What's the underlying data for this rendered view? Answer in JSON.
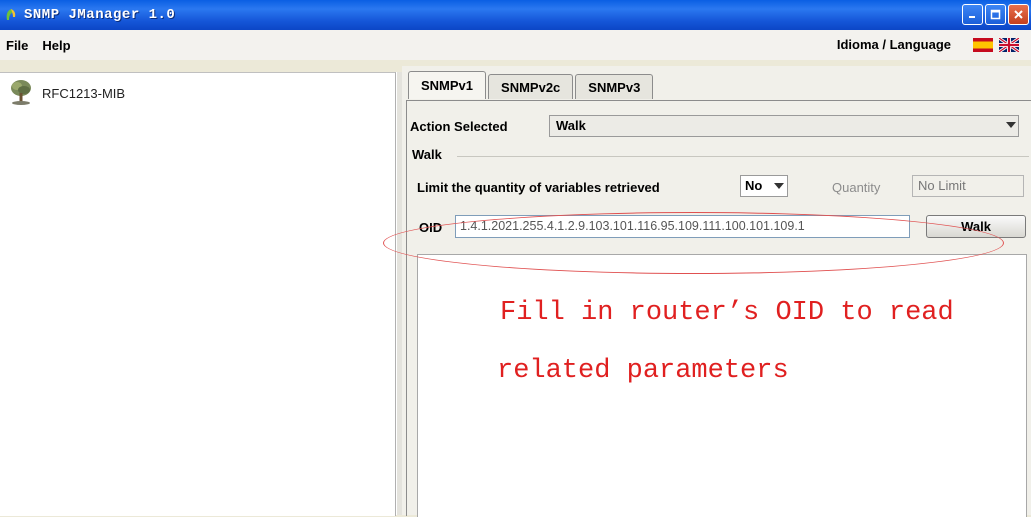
{
  "window": {
    "title": "SNMP JManager 1.0"
  },
  "menubar": {
    "items": [
      "File",
      "Help"
    ],
    "language_label": "Idioma / Language",
    "flags": [
      "spanish-flag-icon",
      "uk-flag-icon"
    ]
  },
  "tree": {
    "root_label": "RFC1213-MIB",
    "root_icon": "tree-icon"
  },
  "tabs": [
    "SNMPv1",
    "SNMPv2c",
    "SNMPv3"
  ],
  "active_tab": "SNMPv1",
  "action": {
    "label": "Action Selected",
    "value": "Walk"
  },
  "walk_section": {
    "legend": "Walk",
    "limit_label": "Limit the quantity of variables retrieved",
    "limit_value": "No",
    "quantity_label": "Quantity",
    "quantity_value": "No Limit",
    "oid_label": "OID",
    "oid_value": "1.4.1.2021.255.4.1.2.9.103.101.116.95.109.111.100.101.109.1",
    "walk_button": "Walk"
  },
  "annotation": {
    "line1": "Fill in router’s OID to read",
    "line2": "related parameters",
    "color": "#e02020"
  },
  "colors": {
    "titlebar": "#1556d8",
    "close_button": "#c4401e"
  }
}
